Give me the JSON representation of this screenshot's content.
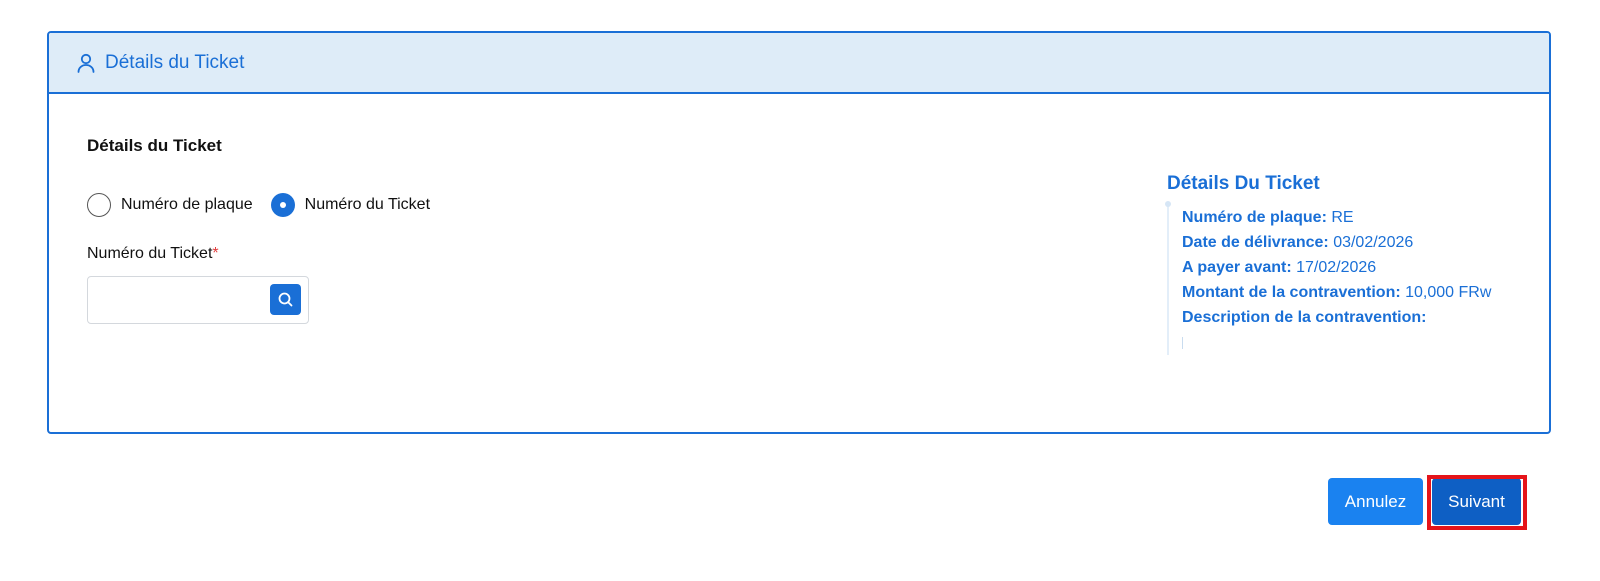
{
  "card": {
    "header_title": "Détails du Ticket",
    "header_icon": "user-icon"
  },
  "form": {
    "section_title": "Détails du Ticket",
    "radio_options": [
      {
        "label": "Numéro de plaque",
        "checked": false
      },
      {
        "label": "Numéro du Ticket",
        "checked": true
      }
    ],
    "field_label": "Numéro du Ticket",
    "required_mark": "*",
    "search_value": "",
    "search_icon": "search-icon"
  },
  "details": {
    "title": "Détails Du Ticket",
    "rows": [
      {
        "key": "Numéro de plaque:",
        "value": "RE"
      },
      {
        "key": "Date de délivrance:",
        "value": "03/02/2026"
      },
      {
        "key": "A payer avant:",
        "value": "17/02/2026"
      },
      {
        "key": "Montant de la contravention:",
        "value": "10,000 FRw"
      },
      {
        "key": "Description de la contravention:",
        "value": ""
      }
    ]
  },
  "actions": {
    "cancel_label": "Annulez",
    "next_label": "Suivant"
  },
  "colors": {
    "accent": "#1a6fd6",
    "header_bg": "#deecf8",
    "cancel_button": "#1a82f0",
    "next_button": "#0e5fc4",
    "required": "#e23b3b",
    "highlight": "#e5141a"
  }
}
